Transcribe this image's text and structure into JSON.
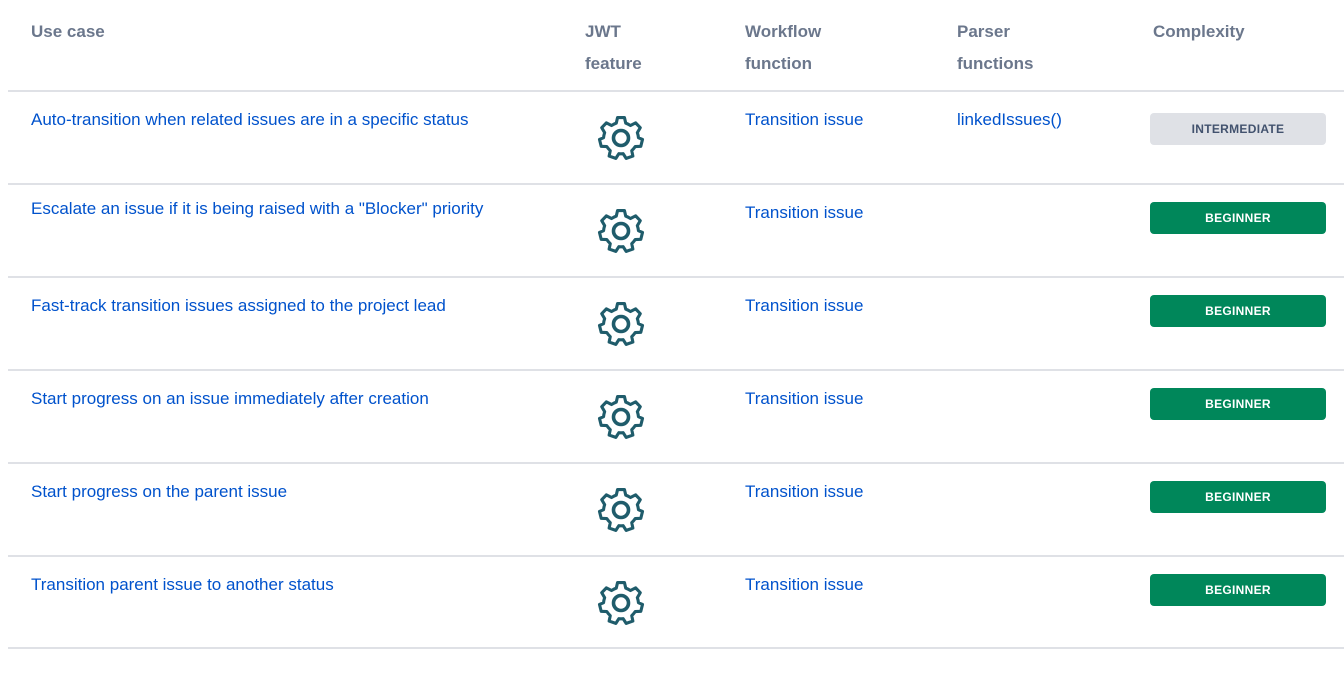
{
  "colors": {
    "link": "#0052cc",
    "header_text": "#6b778c",
    "divider": "#dfe1e6",
    "gear_icon": "#1f5c6b",
    "badge_beginner_bg": "#00875a",
    "badge_intermediate_bg": "#dfe1e6"
  },
  "table": {
    "headers": {
      "use_case": "Use case",
      "jwt_feature": "JWT feature",
      "workflow_function": "Workflow function",
      "parser_functions": "Parser functions",
      "complexity": "Complexity"
    },
    "rows": [
      {
        "use_case": "Auto-transition when related issues are in a specific status",
        "jwt_icon": "gear-icon",
        "workflow_function": "Transition issue",
        "parser_functions": "linkedIssues()",
        "complexity": "INTERMEDIATE"
      },
      {
        "use_case": "Escalate an issue if it is being raised with a \"Blocker\" priority",
        "jwt_icon": "gear-icon",
        "workflow_function": "Transition issue",
        "parser_functions": "",
        "complexity": "BEGINNER"
      },
      {
        "use_case": "Fast-track transition issues assigned to the project lead",
        "jwt_icon": "gear-icon",
        "workflow_function": "Transition issue",
        "parser_functions": "",
        "complexity": "BEGINNER"
      },
      {
        "use_case": "Start progress on an issue immediately after creation",
        "jwt_icon": "gear-icon",
        "workflow_function": "Transition issue",
        "parser_functions": "",
        "complexity": "BEGINNER"
      },
      {
        "use_case": "Start progress on the parent issue",
        "jwt_icon": "gear-icon",
        "workflow_function": "Transition issue",
        "parser_functions": "",
        "complexity": "BEGINNER"
      },
      {
        "use_case": "Transition parent issue to another status",
        "jwt_icon": "gear-icon",
        "workflow_function": "Transition issue",
        "parser_functions": "",
        "complexity": "BEGINNER"
      }
    ]
  }
}
